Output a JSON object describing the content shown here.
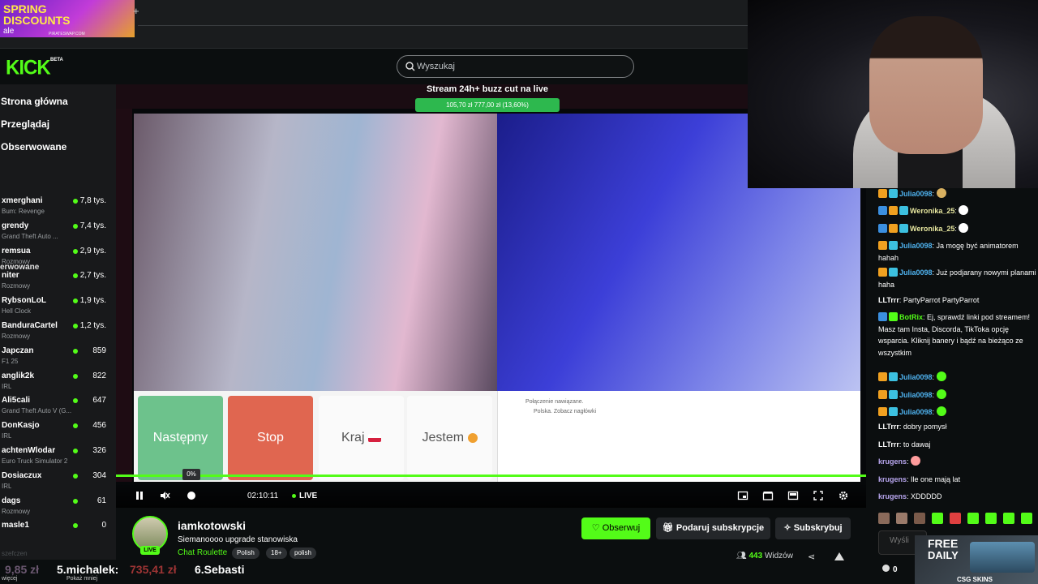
{
  "promo": {
    "line1": "SPRING",
    "line2": "DISCOUNTS",
    "tag": "ale",
    "site": "PIRATESWAP.COM"
  },
  "logo": {
    "text": "KICK",
    "beta": "BETA"
  },
  "search": {
    "placeholder": "Wyszukaj"
  },
  "nav": {
    "home": "Strona główna",
    "browse": "Przeglądaj",
    "following": "Obserwowane",
    "section": "erwowane"
  },
  "channels": [
    {
      "name": "xmerghani",
      "cat": "Bum: Revenge",
      "viewers": "7,8 tys."
    },
    {
      "name": "grendy",
      "cat": "Grand Theft Auto ...",
      "viewers": "7,4 tys."
    },
    {
      "name": "remsua",
      "cat": "Rozmowy",
      "viewers": "2,9 tys."
    },
    {
      "name": "niter",
      "cat": "Rozmowy",
      "viewers": "2,7 tys."
    },
    {
      "name": "RybsonLoL",
      "cat": "Hell Clock",
      "viewers": "1,9 tys."
    },
    {
      "name": "BanduraCartel",
      "cat": "Rozmowy",
      "viewers": "1,2 tys."
    },
    {
      "name": "Japczan",
      "cat": "F1 25",
      "viewers": "859"
    },
    {
      "name": "anglik2k",
      "cat": "IRL",
      "viewers": "822"
    },
    {
      "name": "Ali5cali",
      "cat": "Grand Theft Auto V (G...",
      "viewers": "647"
    },
    {
      "name": "DonKasjo",
      "cat": "IRL",
      "viewers": "456"
    },
    {
      "name": "achtenWlodar",
      "cat": "Euro Truck Simulator 2",
      "viewers": "326"
    },
    {
      "name": "Dosiaczux",
      "cat": "IRL",
      "viewers": "304"
    },
    {
      "name": "dags",
      "cat": "Rozmowy",
      "viewers": "61"
    },
    {
      "name": "masle1",
      "cat": "",
      "viewers": "0"
    }
  ],
  "sidebar_footer": "szefczen",
  "video": {
    "goal_title": "Stream 24h+ buzz cut na live",
    "goal_bar": "105,70 zł   777,00 zł (13,60%)",
    "btn_next": "Następny",
    "btn_stop": "Stop",
    "btn_kraj": "Kraj",
    "btn_jestem": "Jestem",
    "chat_msg1": "Połączenie nawiązane.",
    "chat_msg2": "Polska. Zobacz nagłówki",
    "progress_pct": "0%",
    "progress_value": 0,
    "time": "02:10:11",
    "live": "LIVE"
  },
  "chat": [
    {
      "user": "Julia0098",
      "color": "#4fb3f0",
      "badges": [
        "crown",
        "sub"
      ],
      "text": ""
    },
    {
      "user": "Weronika_25",
      "color": "#e8e8a0",
      "badges": [
        "mod",
        "crown",
        "sub"
      ],
      "text": ""
    },
    {
      "user": "Weronika_25",
      "color": "#e8e8a0",
      "badges": [
        "mod",
        "crown",
        "sub"
      ],
      "text": ""
    },
    {
      "user": "Julia0098",
      "color": "#4fb3f0",
      "badges": [
        "crown",
        "sub"
      ],
      "text": "Ja mogę być animatorem hahah"
    },
    {
      "user": "Julia0098",
      "color": "#4fb3f0",
      "badges": [
        "crown",
        "sub"
      ],
      "text": "Już podjarany nowymi planami haha"
    },
    {
      "user": "LLTrrr",
      "color": "#ffffff",
      "badges": [],
      "text": "PartyParrot PartyParrot"
    },
    {
      "user": "BotRix",
      "color": "#53fc18",
      "badges": [
        "mod",
        "bot"
      ],
      "text": "Ej, sprawdź linki pod streamem! Masz tam Insta, Discorda, TikToka opcję wsparcia. Kliknij banery i bądź na bieżąco ze wszystkim"
    },
    {
      "user": "Julia0098",
      "color": "#4fb3f0",
      "badges": [
        "crown",
        "sub"
      ],
      "text": ""
    },
    {
      "user": "Julia0098",
      "color": "#4fb3f0",
      "badges": [
        "crown",
        "sub"
      ],
      "text": ""
    },
    {
      "user": "Julia0098",
      "color": "#4fb3f0",
      "badges": [
        "crown",
        "sub"
      ],
      "text": ""
    },
    {
      "user": "LLTrrr",
      "color": "#ffffff",
      "badges": [],
      "text": "dobry pomysł"
    },
    {
      "user": "LLTrrr",
      "color": "#ffffff",
      "badges": [],
      "text": "to dawaj"
    },
    {
      "user": "krugens",
      "color": "#b9a7f0",
      "badges": [],
      "text": ""
    },
    {
      "user": "krugens",
      "color": "#b9a7f0",
      "badges": [],
      "text": "Ile one mają lat"
    },
    {
      "user": "krugens",
      "color": "#b9a7f0",
      "badges": [],
      "text": "XDDDDD"
    }
  ],
  "chat_input": {
    "placeholder": "Wyśli"
  },
  "points": "0",
  "csgo": {
    "line1": "FREE",
    "line2": "DAILY",
    "brand": "CSG SKINS"
  },
  "streamer": {
    "name": "iamkotowski",
    "title": "Siemanoooo upgrade stanowiska",
    "category": "Chat Roulette",
    "tags": [
      "Polish",
      "18+",
      "polish"
    ],
    "live": "LIVE",
    "follow": "Obserwuj",
    "gift": "Podaruj subskrypcje",
    "subscribe": "Subskrybuj",
    "viewers": "443",
    "viewers_label": "Widzów"
  },
  "ticker": {
    "a": "9,85 zł",
    "b": "5.michalek:",
    "b_amount": "735,41 zł",
    "c": "6.Sebasti",
    "s1": "więcej",
    "s2": "Pokaż mniej"
  },
  "colors": {
    "accent": "#53fc18",
    "bg": "#0b0e0f",
    "sidebar": "#18191b"
  }
}
